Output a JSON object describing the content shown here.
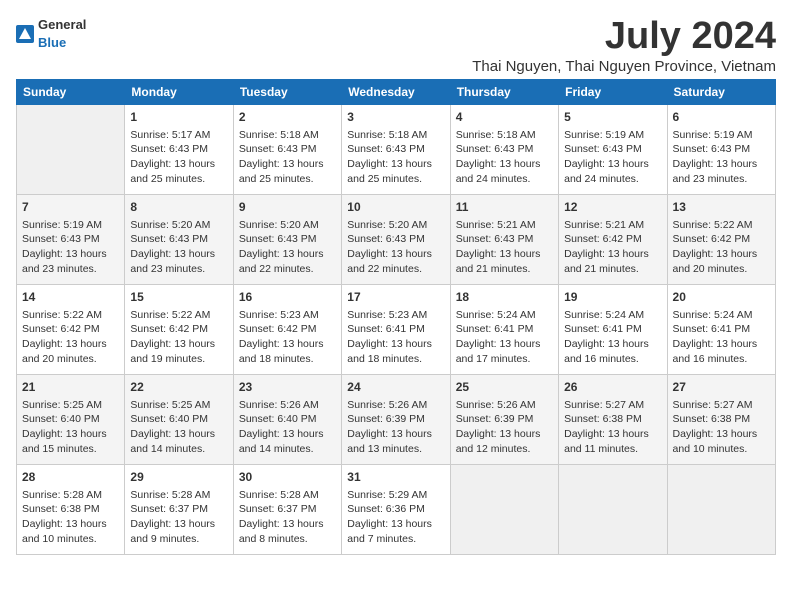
{
  "header": {
    "logo_general": "General",
    "logo_blue": "Blue",
    "month_title": "July 2024",
    "subtitle": "Thai Nguyen, Thai Nguyen Province, Vietnam"
  },
  "weekdays": [
    "Sunday",
    "Monday",
    "Tuesday",
    "Wednesday",
    "Thursday",
    "Friday",
    "Saturday"
  ],
  "weeks": [
    [
      {
        "day": "",
        "sunrise": "",
        "sunset": "",
        "daylight": ""
      },
      {
        "day": "1",
        "sunrise": "Sunrise: 5:17 AM",
        "sunset": "Sunset: 6:43 PM",
        "daylight": "Daylight: 13 hours and 25 minutes."
      },
      {
        "day": "2",
        "sunrise": "Sunrise: 5:18 AM",
        "sunset": "Sunset: 6:43 PM",
        "daylight": "Daylight: 13 hours and 25 minutes."
      },
      {
        "day": "3",
        "sunrise": "Sunrise: 5:18 AM",
        "sunset": "Sunset: 6:43 PM",
        "daylight": "Daylight: 13 hours and 25 minutes."
      },
      {
        "day": "4",
        "sunrise": "Sunrise: 5:18 AM",
        "sunset": "Sunset: 6:43 PM",
        "daylight": "Daylight: 13 hours and 24 minutes."
      },
      {
        "day": "5",
        "sunrise": "Sunrise: 5:19 AM",
        "sunset": "Sunset: 6:43 PM",
        "daylight": "Daylight: 13 hours and 24 minutes."
      },
      {
        "day": "6",
        "sunrise": "Sunrise: 5:19 AM",
        "sunset": "Sunset: 6:43 PM",
        "daylight": "Daylight: 13 hours and 23 minutes."
      }
    ],
    [
      {
        "day": "7",
        "sunrise": "Sunrise: 5:19 AM",
        "sunset": "Sunset: 6:43 PM",
        "daylight": "Daylight: 13 hours and 23 minutes."
      },
      {
        "day": "8",
        "sunrise": "Sunrise: 5:20 AM",
        "sunset": "Sunset: 6:43 PM",
        "daylight": "Daylight: 13 hours and 23 minutes."
      },
      {
        "day": "9",
        "sunrise": "Sunrise: 5:20 AM",
        "sunset": "Sunset: 6:43 PM",
        "daylight": "Daylight: 13 hours and 22 minutes."
      },
      {
        "day": "10",
        "sunrise": "Sunrise: 5:20 AM",
        "sunset": "Sunset: 6:43 PM",
        "daylight": "Daylight: 13 hours and 22 minutes."
      },
      {
        "day": "11",
        "sunrise": "Sunrise: 5:21 AM",
        "sunset": "Sunset: 6:43 PM",
        "daylight": "Daylight: 13 hours and 21 minutes."
      },
      {
        "day": "12",
        "sunrise": "Sunrise: 5:21 AM",
        "sunset": "Sunset: 6:42 PM",
        "daylight": "Daylight: 13 hours and 21 minutes."
      },
      {
        "day": "13",
        "sunrise": "Sunrise: 5:22 AM",
        "sunset": "Sunset: 6:42 PM",
        "daylight": "Daylight: 13 hours and 20 minutes."
      }
    ],
    [
      {
        "day": "14",
        "sunrise": "Sunrise: 5:22 AM",
        "sunset": "Sunset: 6:42 PM",
        "daylight": "Daylight: 13 hours and 20 minutes."
      },
      {
        "day": "15",
        "sunrise": "Sunrise: 5:22 AM",
        "sunset": "Sunset: 6:42 PM",
        "daylight": "Daylight: 13 hours and 19 minutes."
      },
      {
        "day": "16",
        "sunrise": "Sunrise: 5:23 AM",
        "sunset": "Sunset: 6:42 PM",
        "daylight": "Daylight: 13 hours and 18 minutes."
      },
      {
        "day": "17",
        "sunrise": "Sunrise: 5:23 AM",
        "sunset": "Sunset: 6:41 PM",
        "daylight": "Daylight: 13 hours and 18 minutes."
      },
      {
        "day": "18",
        "sunrise": "Sunrise: 5:24 AM",
        "sunset": "Sunset: 6:41 PM",
        "daylight": "Daylight: 13 hours and 17 minutes."
      },
      {
        "day": "19",
        "sunrise": "Sunrise: 5:24 AM",
        "sunset": "Sunset: 6:41 PM",
        "daylight": "Daylight: 13 hours and 16 minutes."
      },
      {
        "day": "20",
        "sunrise": "Sunrise: 5:24 AM",
        "sunset": "Sunset: 6:41 PM",
        "daylight": "Daylight: 13 hours and 16 minutes."
      }
    ],
    [
      {
        "day": "21",
        "sunrise": "Sunrise: 5:25 AM",
        "sunset": "Sunset: 6:40 PM",
        "daylight": "Daylight: 13 hours and 15 minutes."
      },
      {
        "day": "22",
        "sunrise": "Sunrise: 5:25 AM",
        "sunset": "Sunset: 6:40 PM",
        "daylight": "Daylight: 13 hours and 14 minutes."
      },
      {
        "day": "23",
        "sunrise": "Sunrise: 5:26 AM",
        "sunset": "Sunset: 6:40 PM",
        "daylight": "Daylight: 13 hours and 14 minutes."
      },
      {
        "day": "24",
        "sunrise": "Sunrise: 5:26 AM",
        "sunset": "Sunset: 6:39 PM",
        "daylight": "Daylight: 13 hours and 13 minutes."
      },
      {
        "day": "25",
        "sunrise": "Sunrise: 5:26 AM",
        "sunset": "Sunset: 6:39 PM",
        "daylight": "Daylight: 13 hours and 12 minutes."
      },
      {
        "day": "26",
        "sunrise": "Sunrise: 5:27 AM",
        "sunset": "Sunset: 6:38 PM",
        "daylight": "Daylight: 13 hours and 11 minutes."
      },
      {
        "day": "27",
        "sunrise": "Sunrise: 5:27 AM",
        "sunset": "Sunset: 6:38 PM",
        "daylight": "Daylight: 13 hours and 10 minutes."
      }
    ],
    [
      {
        "day": "28",
        "sunrise": "Sunrise: 5:28 AM",
        "sunset": "Sunset: 6:38 PM",
        "daylight": "Daylight: 13 hours and 10 minutes."
      },
      {
        "day": "29",
        "sunrise": "Sunrise: 5:28 AM",
        "sunset": "Sunset: 6:37 PM",
        "daylight": "Daylight: 13 hours and 9 minutes."
      },
      {
        "day": "30",
        "sunrise": "Sunrise: 5:28 AM",
        "sunset": "Sunset: 6:37 PM",
        "daylight": "Daylight: 13 hours and 8 minutes."
      },
      {
        "day": "31",
        "sunrise": "Sunrise: 5:29 AM",
        "sunset": "Sunset: 6:36 PM",
        "daylight": "Daylight: 13 hours and 7 minutes."
      },
      {
        "day": "",
        "sunrise": "",
        "sunset": "",
        "daylight": ""
      },
      {
        "day": "",
        "sunrise": "",
        "sunset": "",
        "daylight": ""
      },
      {
        "day": "",
        "sunrise": "",
        "sunset": "",
        "daylight": ""
      }
    ]
  ]
}
